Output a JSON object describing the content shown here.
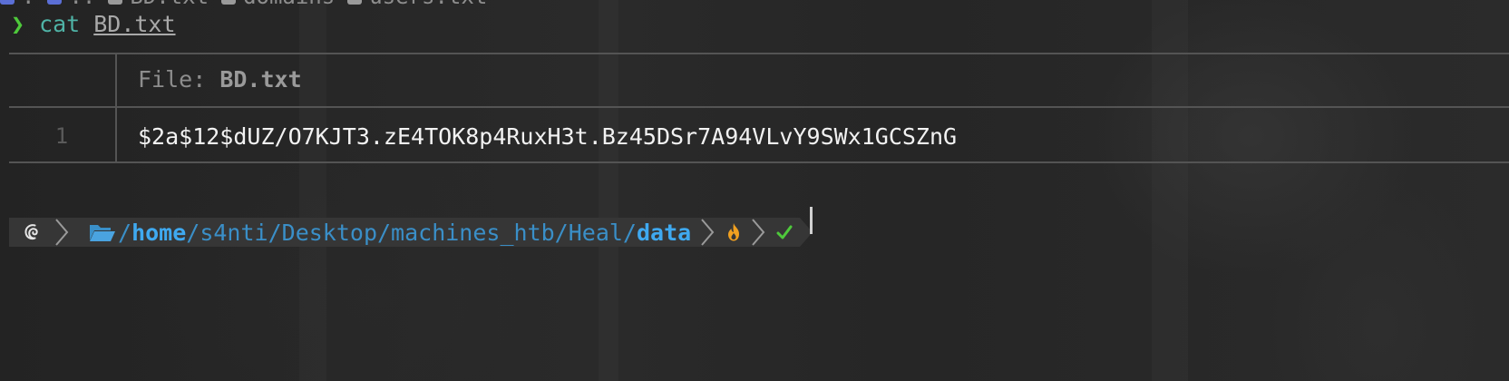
{
  "top_tabs": [
    {
      "icon": "folder-icon",
      "label": "."
    },
    {
      "icon": "folder-icon",
      "label": ".."
    },
    {
      "icon": "file-icon",
      "label": "BD.txt"
    },
    {
      "icon": "file-icon",
      "label": "domains"
    },
    {
      "icon": "file-icon",
      "label": "users.txt"
    }
  ],
  "command": {
    "prompt_symbol": "❯",
    "name": "cat",
    "argument": "BD.txt"
  },
  "bat": {
    "header_label": "File:",
    "file_name": "BD.txt",
    "lines": [
      {
        "number": "1",
        "content": "$2a$12$dUZ/O7KJT3.zE4TOK8p4RuxH3t.Bz45DSr7A94VLvY9SWx1GCSZnG"
      }
    ]
  },
  "prompt": {
    "os_icon": "debian-swirl-icon",
    "folder_icon": "open-folder-icon",
    "path_prefix": "/",
    "path_home": "home",
    "path_middle": "/s4nti/Desktop/machines_htb/Heal/",
    "path_current": "data",
    "status_icons": [
      "flame-icon",
      "checkmark-icon"
    ]
  },
  "colors": {
    "background": "#262626",
    "prompt_green": "#4ec93b",
    "command_teal": "#4fb3a6",
    "path_blue": "#3fa9f0",
    "powerline_bg": "#363636",
    "flame": "#f0a020"
  }
}
